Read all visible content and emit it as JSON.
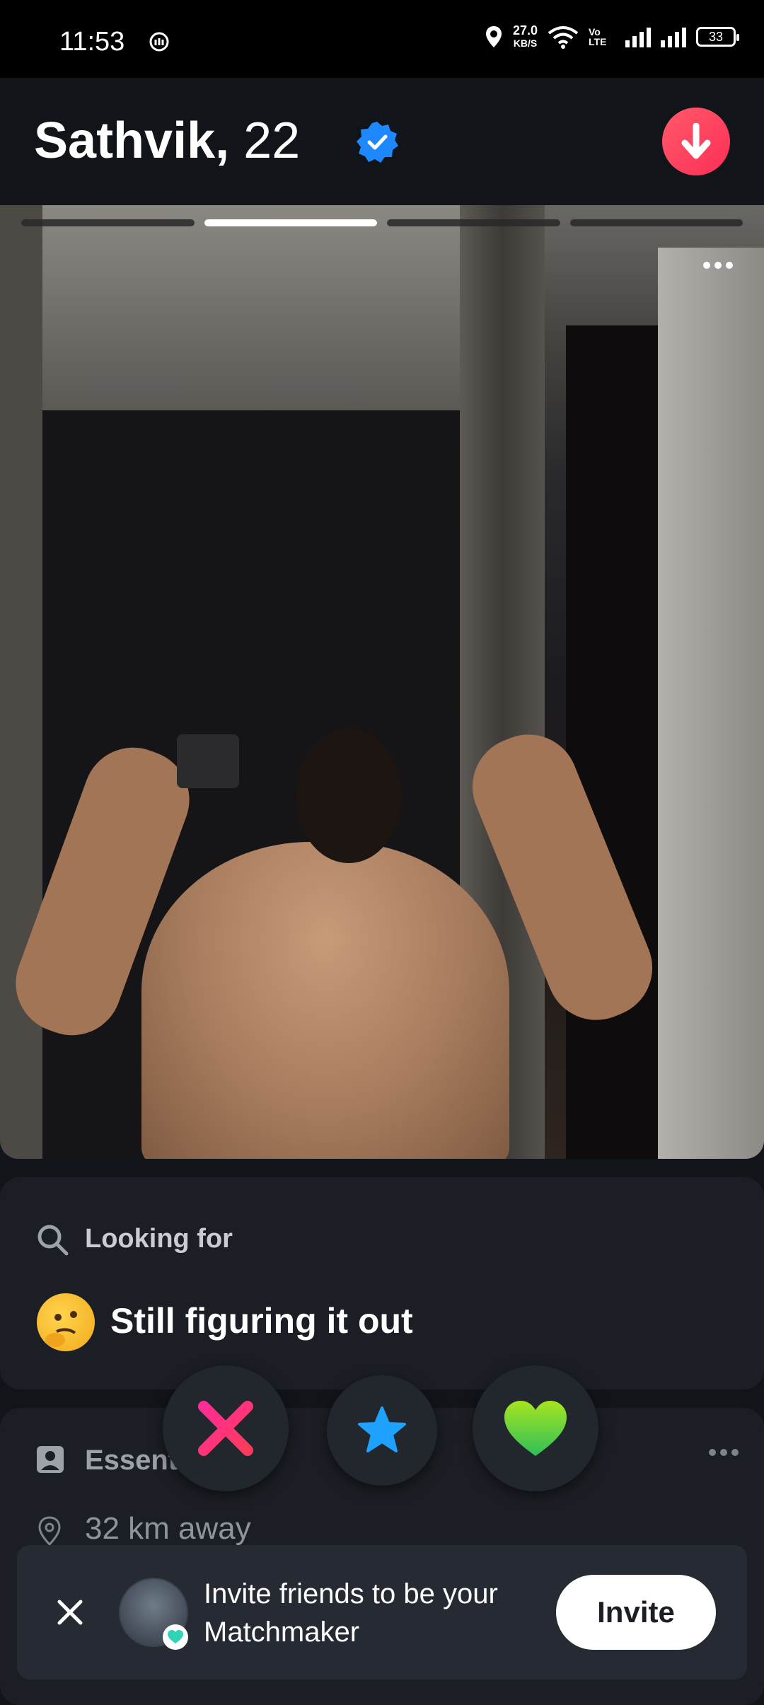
{
  "status_bar": {
    "time": "11:53",
    "net_speed_value": "27.0",
    "net_speed_unit": "KB/S",
    "volte_label": "Vo LTE",
    "battery": "33"
  },
  "profile": {
    "name": "Sathvik,",
    "age": "22",
    "verified": true,
    "photo_count": 4,
    "active_photo_index": 1
  },
  "looking_for": {
    "label": "Looking for",
    "emoji": "thinking-face-emoji",
    "value": "Still figuring it out"
  },
  "essentials": {
    "label": "Essent",
    "distance": "32 km away"
  },
  "actions": {
    "nope": "close-x-icon",
    "super_like": "star-icon",
    "like": "heart-icon"
  },
  "invite_banner": {
    "text": "Invite friends to be your Matchmaker",
    "button_label": "Invite"
  },
  "colors": {
    "background": "#111419",
    "card": "#1b1e24",
    "accent_red": "#fe2e55",
    "verified_blue": "#1e88ff",
    "nope_pink": "#ff2d7a",
    "super_like_blue": "#1ea1ff",
    "like_green": "#5fd33a"
  }
}
